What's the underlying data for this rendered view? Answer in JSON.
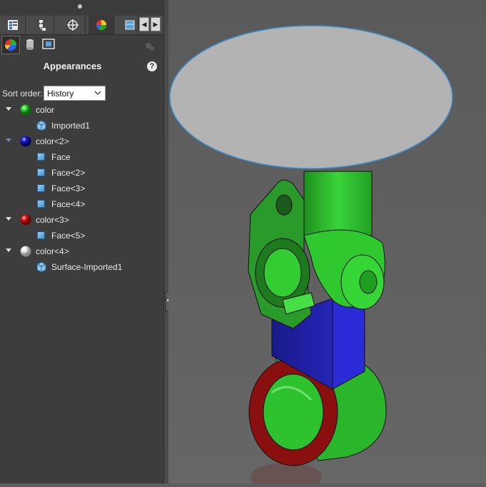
{
  "panel": {
    "title": "Appearances",
    "help_glyph": "?",
    "sort_label": "Sort order:",
    "sort_value": "History",
    "tabs": [
      "feature-manager-icon",
      "property-manager-icon",
      "configuration-manager-icon",
      "display-manager-icon",
      "cam-icon"
    ],
    "subtools": [
      "appearances-icon",
      "decals-icon",
      "scenes-icon"
    ],
    "tree": [
      {
        "label": "color",
        "icon": "green-ball-icon",
        "color": "#27d827",
        "level": 0
      },
      {
        "label": "Imported1",
        "icon": "part-icon",
        "level": 1
      },
      {
        "label": "color<2>",
        "icon": "blue-ball-icon",
        "color": "#1919d8",
        "level": 0
      },
      {
        "label": "Face",
        "icon": "face-icon",
        "level": 1
      },
      {
        "label": "Face<2>",
        "icon": "face-icon",
        "level": 1
      },
      {
        "label": "Face<3>",
        "icon": "face-icon",
        "level": 1
      },
      {
        "label": "Face<4>",
        "icon": "face-icon",
        "level": 1
      },
      {
        "label": "color<3>",
        "icon": "red-ball-icon",
        "color": "#e01818",
        "level": 0
      },
      {
        "label": "Face<5>",
        "icon": "face-icon",
        "level": 1
      },
      {
        "label": "color<4>",
        "icon": "white-ball-icon",
        "color": "#f2f2f2",
        "level": 0
      },
      {
        "label": "Surface-Imported1",
        "icon": "part-icon",
        "level": 1
      }
    ]
  },
  "colors": {
    "panel_bg": "#3d3d3d",
    "viewport_bg": "#5e5e5e",
    "part_green": "#2fc92f",
    "part_blue": "#2020b0",
    "part_red": "#9a1010",
    "surface_gray": "#b4b4b4"
  }
}
